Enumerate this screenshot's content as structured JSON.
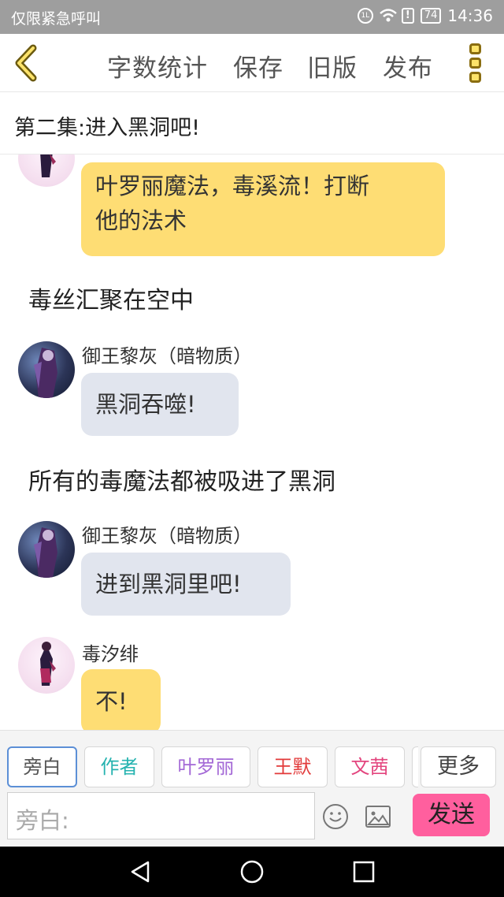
{
  "status_bar": {
    "carrier": "仅限紧急呼叫",
    "battery": "74",
    "time": "14:36"
  },
  "toolbar": {
    "items": [
      "字数统计",
      "保存",
      "旧版",
      "发布"
    ]
  },
  "episode": {
    "title": "第二集:进入黑洞吧!"
  },
  "chat": [
    {
      "type": "message",
      "speaker": "",
      "style": "yellow",
      "text_lines": [
        "叶罗丽魔法，毒溪流！打断",
        "他的法术"
      ]
    },
    {
      "type": "narration",
      "text": "毒丝汇聚在空中"
    },
    {
      "type": "message",
      "speaker": "御王黎灰（暗物质）",
      "style": "gray",
      "text": "黑洞吞噬!"
    },
    {
      "type": "narration",
      "text": "所有的毒魔法都被吸进了黑洞"
    },
    {
      "type": "message",
      "speaker": "御王黎灰（暗物质）",
      "style": "gray",
      "text": "进到黑洞里吧!"
    },
    {
      "type": "message",
      "speaker": "毒汐绯",
      "style": "yellow",
      "text": "不!"
    }
  ],
  "roles": [
    {
      "label": "旁白",
      "color": "#555555"
    },
    {
      "label": "作者",
      "color": "#26b3b0"
    },
    {
      "label": "叶罗丽",
      "color": "#a368d6"
    },
    {
      "label": "王默",
      "color": "#e23a3a"
    },
    {
      "label": "文茜",
      "color": "#e3457e"
    },
    {
      "label": "更多",
      "color": "#444444"
    }
  ],
  "input": {
    "placeholder": "旁白:"
  },
  "send_label": "发送",
  "colors": {
    "accent_yellow": "#fedd74",
    "bubble_gray": "#e1e5ee",
    "send_pink": "#ff5f9e"
  }
}
